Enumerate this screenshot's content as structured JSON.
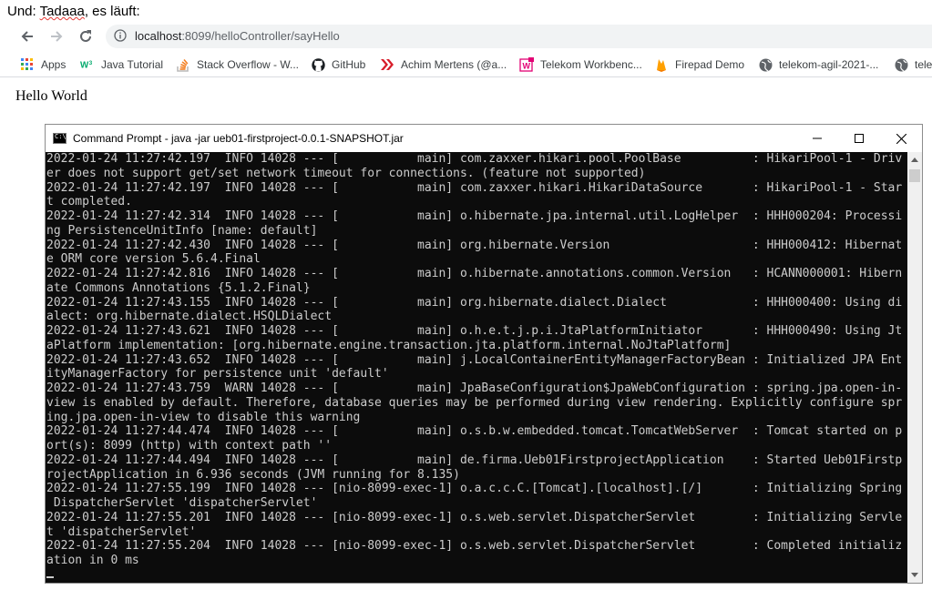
{
  "caption": {
    "prefix": "Und: ",
    "word": "Tadaaa",
    "suffix": ", es läuft:"
  },
  "browser": {
    "url_host": "localhost",
    "url_path": ":8099/helloController/sayHello",
    "bookmarks": [
      {
        "label": "Apps",
        "icon": "apps-grid-icon"
      },
      {
        "label": "Java Tutorial",
        "icon": "w3schools-icon"
      },
      {
        "label": "Stack Overflow - W...",
        "icon": "stackoverflow-icon"
      },
      {
        "label": "GitHub",
        "icon": "github-icon"
      },
      {
        "label": "Achim Mertens (@a...",
        "icon": "chevrons-icon"
      },
      {
        "label": "Telekom Workbenc...",
        "icon": "telekom-icon"
      },
      {
        "label": "Firepad Demo",
        "icon": "firepad-icon"
      },
      {
        "label": "telekom-agil-2021-...",
        "icon": "globe-icon"
      },
      {
        "label": "tele",
        "icon": "globe-icon"
      }
    ]
  },
  "page": {
    "body_text": "Hello World"
  },
  "cmd_window": {
    "title": "Command Prompt - java  -jar ueb01-firstproject-0.0.1-SNAPSHOT.jar",
    "lines": [
      "2022-01-24 11:27:42.197  INFO 14028 --- [           main] com.zaxxer.hikari.pool.PoolBase          : HikariPool-1 - Driv",
      "er does not support get/set network timeout for connections. (feature not supported)",
      "2022-01-24 11:27:42.197  INFO 14028 --- [           main] com.zaxxer.hikari.HikariDataSource       : HikariPool-1 - Star",
      "t completed.",
      "2022-01-24 11:27:42.314  INFO 14028 --- [           main] o.hibernate.jpa.internal.util.LogHelper  : HHH000204: Processi",
      "ng PersistenceUnitInfo [name: default]",
      "2022-01-24 11:27:42.430  INFO 14028 --- [           main] org.hibernate.Version                    : HHH000412: Hibernat",
      "e ORM core version 5.6.4.Final",
      "2022-01-24 11:27:42.816  INFO 14028 --- [           main] o.hibernate.annotations.common.Version   : HCANN000001: Hibern",
      "ate Commons Annotations {5.1.2.Final}",
      "2022-01-24 11:27:43.155  INFO 14028 --- [           main] org.hibernate.dialect.Dialect            : HHH000400: Using di",
      "alect: org.hibernate.dialect.HSQLDialect",
      "2022-01-24 11:27:43.621  INFO 14028 --- [           main] o.h.e.t.j.p.i.JtaPlatformInitiator       : HHH000490: Using Jt",
      "aPlatform implementation: [org.hibernate.engine.transaction.jta.platform.internal.NoJtaPlatform]",
      "2022-01-24 11:27:43.652  INFO 14028 --- [           main] j.LocalContainerEntityManagerFactoryBean : Initialized JPA Ent",
      "ityManagerFactory for persistence unit 'default'",
      "2022-01-24 11:27:43.759  WARN 14028 --- [           main] JpaBaseConfiguration$JpaWebConfiguration : spring.jpa.open-in-",
      "view is enabled by default. Therefore, database queries may be performed during view rendering. Explicitly configure spr",
      "ing.jpa.open-in-view to disable this warning",
      "2022-01-24 11:27:44.474  INFO 14028 --- [           main] o.s.b.w.embedded.tomcat.TomcatWebServer  : Tomcat started on p",
      "ort(s): 8099 (http) with context path ''",
      "2022-01-24 11:27:44.494  INFO 14028 --- [           main] de.firma.Ueb01FirstprojectApplication    : Started Ueb01Firstp",
      "rojectApplication in 6.936 seconds (JVM running for 8.135)",
      "2022-01-24 11:27:55.199  INFO 14028 --- [nio-8099-exec-1] o.a.c.c.C.[Tomcat].[localhost].[/]       : Initializing Spring",
      " DispatcherServlet 'dispatcherServlet'",
      "2022-01-24 11:27:55.201  INFO 14028 --- [nio-8099-exec-1] o.s.web.servlet.DispatcherServlet        : Initializing Servle",
      "t 'dispatcherServlet'",
      "2022-01-24 11:27:55.204  INFO 14028 --- [nio-8099-exec-1] o.s.web.servlet.DispatcherServlet        : Completed initializ",
      "ation in 0 ms"
    ]
  },
  "colors": {
    "console_bg": "#0c0c0c",
    "console_fg": "#cccccc",
    "omnibox_bg": "#f1f3f4"
  }
}
